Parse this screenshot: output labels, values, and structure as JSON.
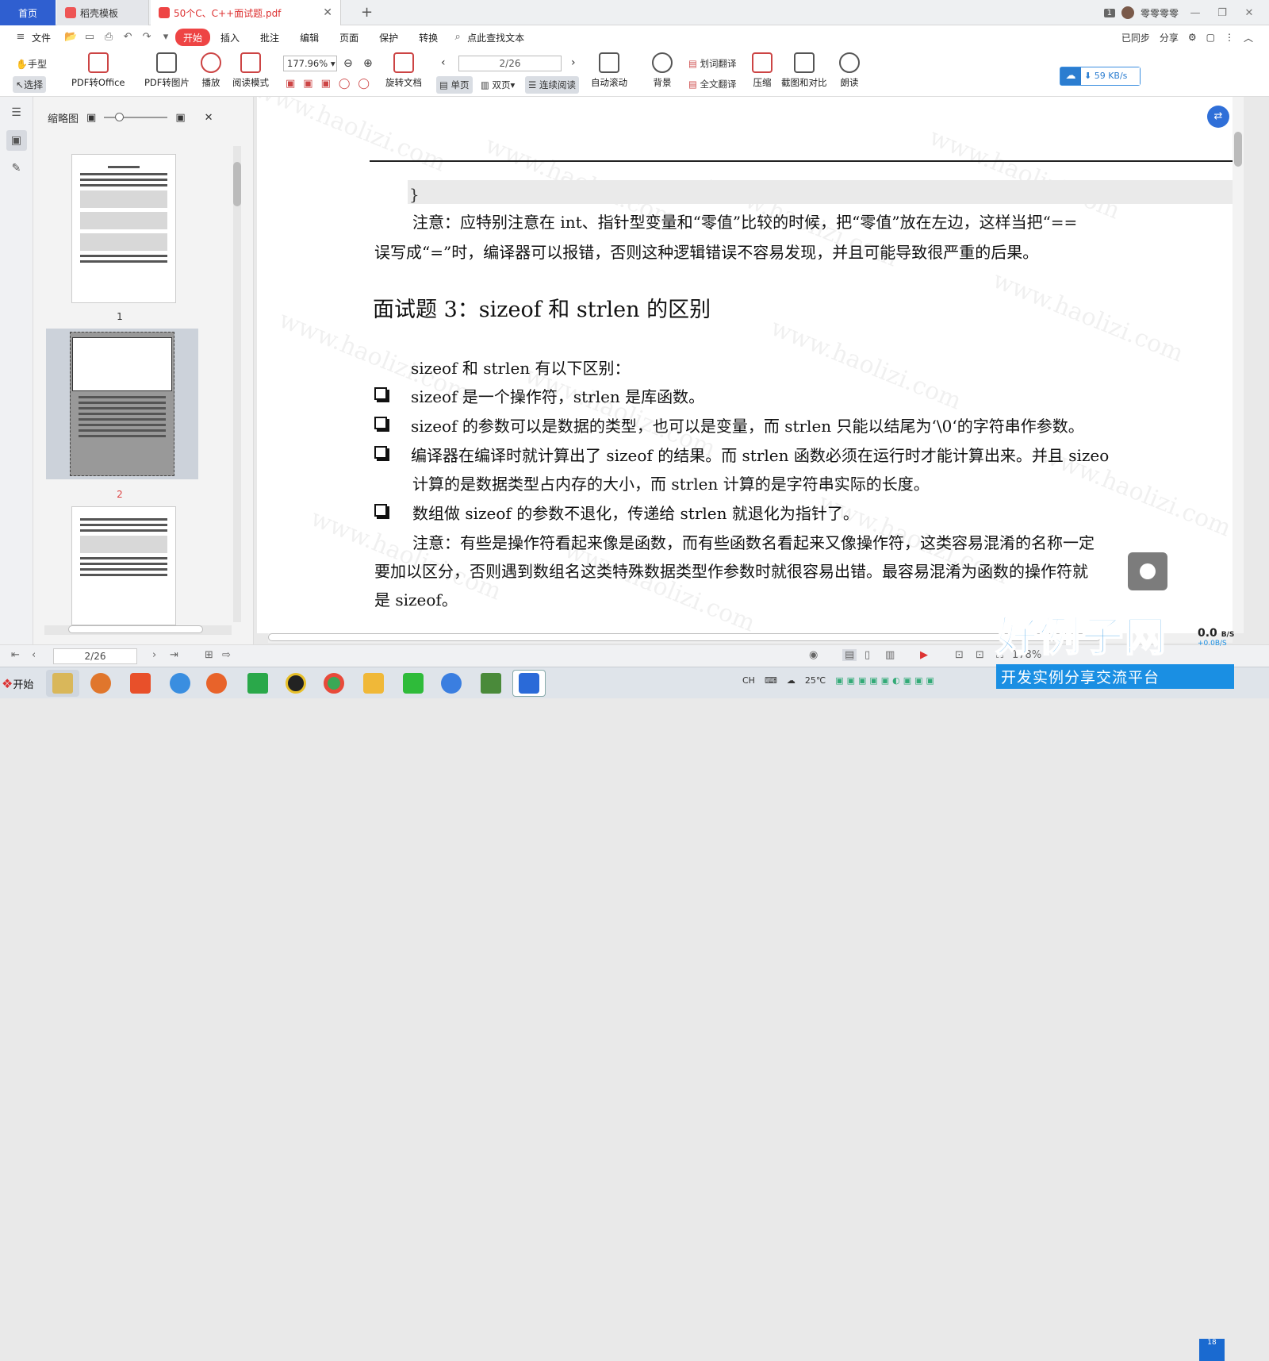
{
  "tabs": {
    "home": "首页",
    "template": "稻壳模板",
    "pdf": "50个C、C++面试题.pdf",
    "new": "+"
  },
  "titlebar": {
    "badge": "1",
    "user": "零零零零"
  },
  "menu": {
    "file": "文件",
    "items": [
      "开始",
      "插入",
      "批注",
      "编辑",
      "页面",
      "保护",
      "转换"
    ],
    "search": "点此查找文本",
    "synced": "已同步",
    "share": "分享"
  },
  "toolbar": {
    "hand": "手型",
    "select": "选择",
    "pdf_to_office": "PDF转Office",
    "pdf_to_image": "PDF转图片",
    "play": "播放",
    "read_mode": "阅读模式",
    "zoom": "177.96%",
    "page": "2/26",
    "rotate": "旋转文档",
    "single": "单页",
    "double": "双页",
    "continuous": "连续阅读",
    "auto_scroll": "自动滚动",
    "background": "背景",
    "word_translate": "划词翻译",
    "full_translate": "全文翻译",
    "compress": "压缩",
    "compare": "截图和对比",
    "read_aloud": "朗读",
    "speed": "59 KB/s"
  },
  "sidebar": {
    "title": "缩略图",
    "page1": "1",
    "page2": "2"
  },
  "doc": {
    "brace": "}",
    "note1_line1": "注意：应特别注意在 int、指针型变量和“零值”比较的时候，把“零值”放在左边，这样当把“==",
    "note1_line2": "误写成“=”时，编译器可以报错，否则这种逻辑错误不容易发现，并且可能导致很严重的后果。",
    "heading": "面试题 3：sizeof 和 strlen 的区别",
    "intro": "sizeof 和 strlen 有以下区别：",
    "b1": "sizeof 是一个操作符，strlen 是库函数。",
    "b2": "sizeof 的参数可以是数据的类型，也可以是变量，而 strlen 只能以结尾为‘\\0‘的字符串作参数。",
    "b3_l1": "编译器在编译时就计算出了 sizeof 的结果。而 strlen 函数必须在运行时才能计算出来。并且 sizeo",
    "b3_l2": "计算的是数据类型占内存的大小，而 strlen 计算的是字符串实际的长度。",
    "b4": "数组做 sizeof 的参数不退化，传递给 strlen 就退化为指针了。",
    "note2_l1": "注意：有些是操作符看起来像是函数，而有些函数名看起来又像操作符，这类容易混淆的名称一定",
    "note2_l2": "要加以区分，否则遇到数组名这类特殊数据类型作参数时就很容易出错。最容易混淆为函数的操作符就",
    "note2_l3": "是 sizeof。",
    "watermark": "www.haolizi.com"
  },
  "status": {
    "page": "2/26",
    "zoom": "178%"
  },
  "taskbar": {
    "start": "开始",
    "lang": "CH",
    "temp": "25℃",
    "clock": "18"
  },
  "brand": {
    "name": "好例子网",
    "slogan": "开发实例分享交流平台"
  },
  "net": {
    "up": "0.0",
    "unit": "B/S",
    "down": "+0.0B/S"
  }
}
